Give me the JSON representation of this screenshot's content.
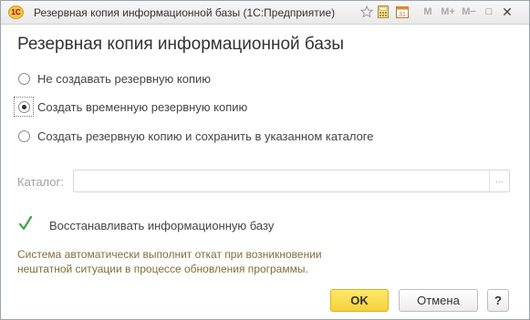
{
  "window": {
    "title": "Резервная копия информационной базы  (1С:Предприятие)",
    "logo_text": "1С",
    "toolbar": {
      "m_label": "M",
      "m_plus_label": "M+",
      "m_minus_label": "M−",
      "restore_label": "□",
      "close_label": "✕"
    }
  },
  "heading": "Резервная копия информационной базы",
  "backup_options": [
    {
      "label": "Не создавать резервную копию",
      "checked": false
    },
    {
      "label": "Создать временную резервную копию",
      "checked": true
    },
    {
      "label": "Создать резервную копию и сохранить в указанном каталоге",
      "checked": false
    }
  ],
  "catalog": {
    "label": "Каталог:",
    "value": "",
    "select_button_label": "..."
  },
  "restore_checkbox": {
    "label": "Восстанавливать информационную базу",
    "checked": true
  },
  "note": {
    "line1": "Система автоматически выполнит откат при возникновении",
    "line2": "нештатной ситуации в процессе обновления  программы."
  },
  "buttons": {
    "ok": "OK",
    "cancel": "Отмена",
    "help": "?"
  },
  "colors": {
    "accent_ok": "#f6d23b",
    "note_text": "#7f6f3b",
    "checkmark": "#3fa33f"
  }
}
